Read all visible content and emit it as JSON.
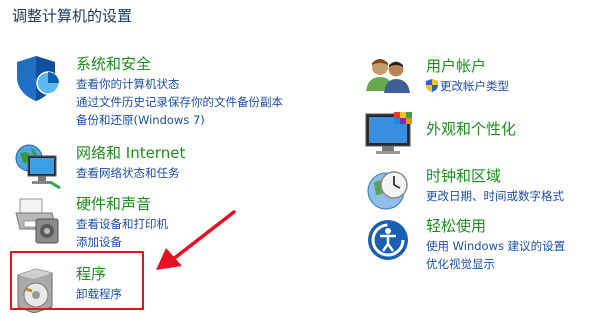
{
  "page": {
    "title": "调整计算机的设置"
  },
  "categories": {
    "system_security": {
      "title": "系统和安全",
      "links": [
        "查看你的计算机状态",
        "通过文件历史记录保存你的文件备份副本",
        "备份和还原(Windows 7)"
      ],
      "icon": "shield-pie-icon"
    },
    "network": {
      "title": "网络和 Internet",
      "links": [
        "查看网络状态和任务"
      ],
      "icon": "network-globe-icon"
    },
    "hardware_sound": {
      "title": "硬件和声音",
      "links": [
        "查看设备和打印机",
        "添加设备"
      ],
      "icon": "printer-icon"
    },
    "programs": {
      "title": "程序",
      "links": [
        "卸载程序"
      ],
      "icon": "program-disc-icon"
    },
    "user_accounts": {
      "title": "用户帐户",
      "links": [
        "更改帐户类型"
      ],
      "icon": "users-icon"
    },
    "appearance": {
      "title": "外观和个性化",
      "links": [],
      "icon": "monitor-palette-icon"
    },
    "clock_region": {
      "title": "时钟和区域",
      "links": [
        "更改日期、时间或数字格式"
      ],
      "icon": "clock-globe-icon"
    },
    "ease_access": {
      "title": "轻松使用",
      "links": [
        "使用 Windows 建议的设置",
        "优化视觉显示"
      ],
      "icon": "ease-of-access-icon"
    }
  },
  "colors": {
    "category_title": "#1b8e1b",
    "link": "#1e4fa8",
    "page_title": "#1e395b",
    "annotation": "#e81123"
  }
}
